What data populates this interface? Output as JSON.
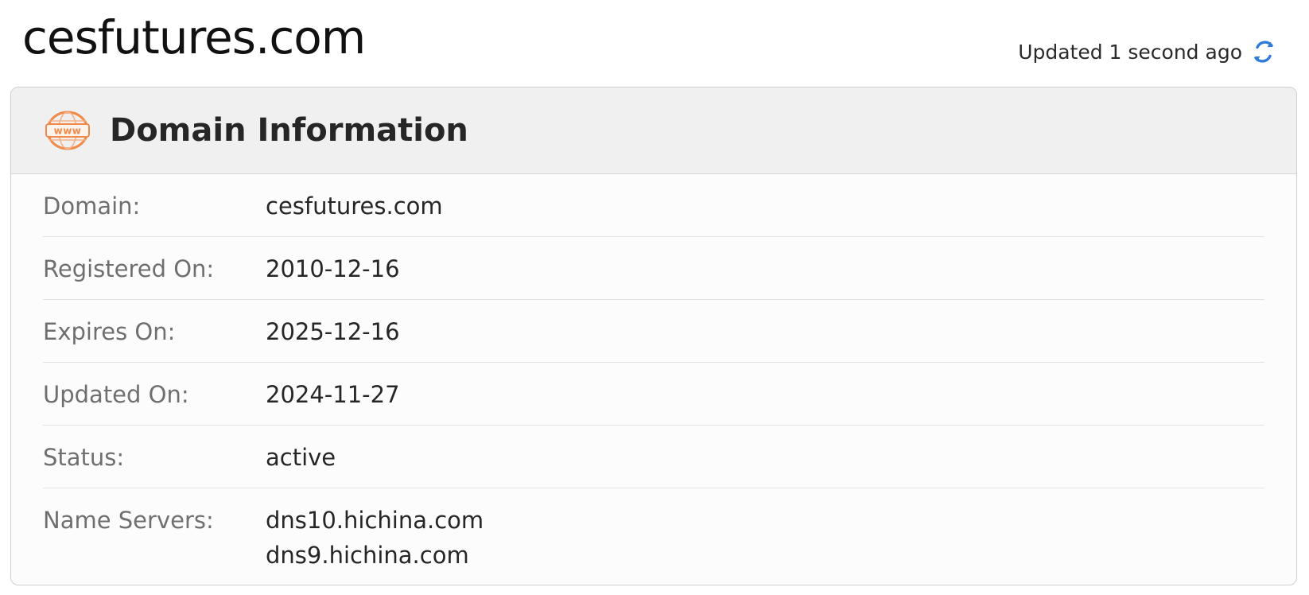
{
  "header": {
    "domain_title": "cesfutures.com",
    "updated_text": "Updated 1 second ago",
    "refresh_icon": "refresh-icon"
  },
  "card": {
    "icon": "www-globe-icon",
    "icon_text": "www",
    "title": "Domain Information",
    "rows": [
      {
        "label": "Domain:",
        "value": "cesfutures.com"
      },
      {
        "label": "Registered On:",
        "value": "2010-12-16"
      },
      {
        "label": "Expires On:",
        "value": "2025-12-16"
      },
      {
        "label": "Updated On:",
        "value": "2024-11-27"
      },
      {
        "label": "Status:",
        "value": "active"
      },
      {
        "label": "Name Servers:",
        "values": [
          "dns10.hichina.com",
          "dns9.hichina.com"
        ]
      }
    ]
  },
  "colors": {
    "accent_orange": "#f08a4b",
    "refresh_blue": "#2f7bd9",
    "header_bg": "#f0f0f0"
  }
}
